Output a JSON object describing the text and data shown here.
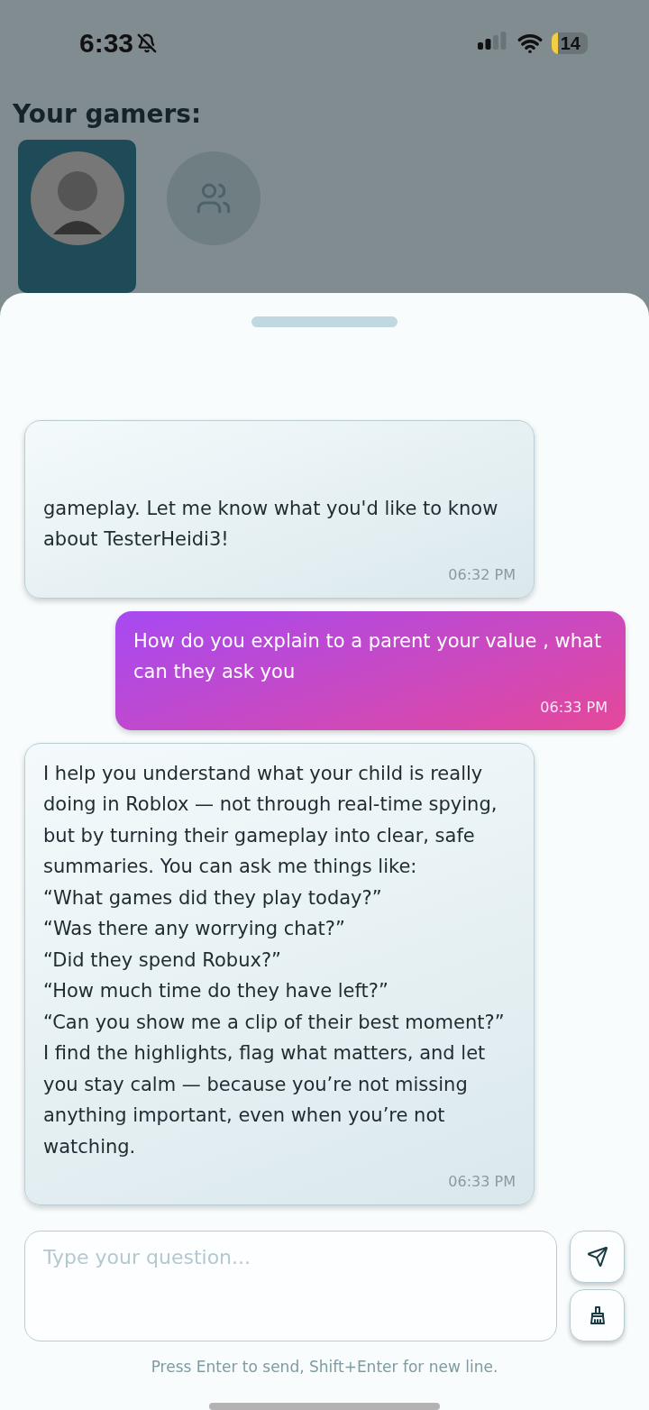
{
  "status_bar": {
    "time": "6:33",
    "battery": "14"
  },
  "heading": "Your gamers:",
  "gamers": [
    {
      "kind": "avatar",
      "selected": true
    },
    {
      "kind": "group",
      "selected": false
    }
  ],
  "messages": [
    {
      "kind": "bot",
      "text": "gameplay. Let me know what you'd like to know about TesterHeidi3!",
      "time": "06:32 PM"
    },
    {
      "kind": "user",
      "text": "How do you explain to a parent your value , what can they ask you",
      "time": "06:33 PM"
    },
    {
      "kind": "bot",
      "text": "I help you understand what your child is really doing in Roblox — not through real-time spying, but by turning their gameplay into clear, safe summaries. You can ask me things like:\n“What games did they play today?”\n“Was there any worrying chat?”\n“Did they spend Robux?”\n“How much time do they have left?”\n“Can you show me a clip of their best moment?”\nI find the highlights, flag what matters, and let you stay calm — because you’re not missing anything important, even when you’re not watching.",
      "time": "06:33 PM"
    }
  ],
  "composer": {
    "placeholder": "Type your question..."
  },
  "hint": "Press Enter to send, Shift+Enter for new line."
}
